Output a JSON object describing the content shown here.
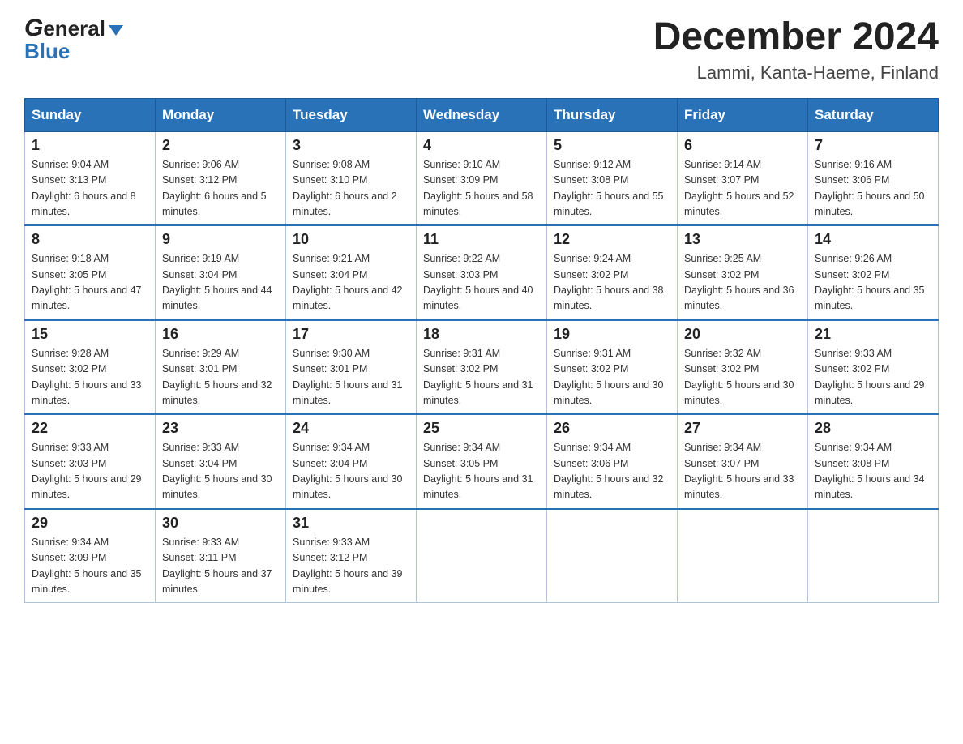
{
  "header": {
    "logo_general": "General",
    "logo_blue": "Blue",
    "title": "December 2024",
    "location": "Lammi, Kanta-Haeme, Finland"
  },
  "days_of_week": [
    "Sunday",
    "Monday",
    "Tuesday",
    "Wednesday",
    "Thursday",
    "Friday",
    "Saturday"
  ],
  "weeks": [
    [
      {
        "day": "1",
        "sunrise": "9:04 AM",
        "sunset": "3:13 PM",
        "daylight": "6 hours and 8 minutes."
      },
      {
        "day": "2",
        "sunrise": "9:06 AM",
        "sunset": "3:12 PM",
        "daylight": "6 hours and 5 minutes."
      },
      {
        "day": "3",
        "sunrise": "9:08 AM",
        "sunset": "3:10 PM",
        "daylight": "6 hours and 2 minutes."
      },
      {
        "day": "4",
        "sunrise": "9:10 AM",
        "sunset": "3:09 PM",
        "daylight": "5 hours and 58 minutes."
      },
      {
        "day": "5",
        "sunrise": "9:12 AM",
        "sunset": "3:08 PM",
        "daylight": "5 hours and 55 minutes."
      },
      {
        "day": "6",
        "sunrise": "9:14 AM",
        "sunset": "3:07 PM",
        "daylight": "5 hours and 52 minutes."
      },
      {
        "day": "7",
        "sunrise": "9:16 AM",
        "sunset": "3:06 PM",
        "daylight": "5 hours and 50 minutes."
      }
    ],
    [
      {
        "day": "8",
        "sunrise": "9:18 AM",
        "sunset": "3:05 PM",
        "daylight": "5 hours and 47 minutes."
      },
      {
        "day": "9",
        "sunrise": "9:19 AM",
        "sunset": "3:04 PM",
        "daylight": "5 hours and 44 minutes."
      },
      {
        "day": "10",
        "sunrise": "9:21 AM",
        "sunset": "3:04 PM",
        "daylight": "5 hours and 42 minutes."
      },
      {
        "day": "11",
        "sunrise": "9:22 AM",
        "sunset": "3:03 PM",
        "daylight": "5 hours and 40 minutes."
      },
      {
        "day": "12",
        "sunrise": "9:24 AM",
        "sunset": "3:02 PM",
        "daylight": "5 hours and 38 minutes."
      },
      {
        "day": "13",
        "sunrise": "9:25 AM",
        "sunset": "3:02 PM",
        "daylight": "5 hours and 36 minutes."
      },
      {
        "day": "14",
        "sunrise": "9:26 AM",
        "sunset": "3:02 PM",
        "daylight": "5 hours and 35 minutes."
      }
    ],
    [
      {
        "day": "15",
        "sunrise": "9:28 AM",
        "sunset": "3:02 PM",
        "daylight": "5 hours and 33 minutes."
      },
      {
        "day": "16",
        "sunrise": "9:29 AM",
        "sunset": "3:01 PM",
        "daylight": "5 hours and 32 minutes."
      },
      {
        "day": "17",
        "sunrise": "9:30 AM",
        "sunset": "3:01 PM",
        "daylight": "5 hours and 31 minutes."
      },
      {
        "day": "18",
        "sunrise": "9:31 AM",
        "sunset": "3:02 PM",
        "daylight": "5 hours and 31 minutes."
      },
      {
        "day": "19",
        "sunrise": "9:31 AM",
        "sunset": "3:02 PM",
        "daylight": "5 hours and 30 minutes."
      },
      {
        "day": "20",
        "sunrise": "9:32 AM",
        "sunset": "3:02 PM",
        "daylight": "5 hours and 30 minutes."
      },
      {
        "day": "21",
        "sunrise": "9:33 AM",
        "sunset": "3:02 PM",
        "daylight": "5 hours and 29 minutes."
      }
    ],
    [
      {
        "day": "22",
        "sunrise": "9:33 AM",
        "sunset": "3:03 PM",
        "daylight": "5 hours and 29 minutes."
      },
      {
        "day": "23",
        "sunrise": "9:33 AM",
        "sunset": "3:04 PM",
        "daylight": "5 hours and 30 minutes."
      },
      {
        "day": "24",
        "sunrise": "9:34 AM",
        "sunset": "3:04 PM",
        "daylight": "5 hours and 30 minutes."
      },
      {
        "day": "25",
        "sunrise": "9:34 AM",
        "sunset": "3:05 PM",
        "daylight": "5 hours and 31 minutes."
      },
      {
        "day": "26",
        "sunrise": "9:34 AM",
        "sunset": "3:06 PM",
        "daylight": "5 hours and 32 minutes."
      },
      {
        "day": "27",
        "sunrise": "9:34 AM",
        "sunset": "3:07 PM",
        "daylight": "5 hours and 33 minutes."
      },
      {
        "day": "28",
        "sunrise": "9:34 AM",
        "sunset": "3:08 PM",
        "daylight": "5 hours and 34 minutes."
      }
    ],
    [
      {
        "day": "29",
        "sunrise": "9:34 AM",
        "sunset": "3:09 PM",
        "daylight": "5 hours and 35 minutes."
      },
      {
        "day": "30",
        "sunrise": "9:33 AM",
        "sunset": "3:11 PM",
        "daylight": "5 hours and 37 minutes."
      },
      {
        "day": "31",
        "sunrise": "9:33 AM",
        "sunset": "3:12 PM",
        "daylight": "5 hours and 39 minutes."
      },
      null,
      null,
      null,
      null
    ]
  ],
  "labels": {
    "sunrise": "Sunrise:",
    "sunset": "Sunset:",
    "daylight": "Daylight:"
  }
}
